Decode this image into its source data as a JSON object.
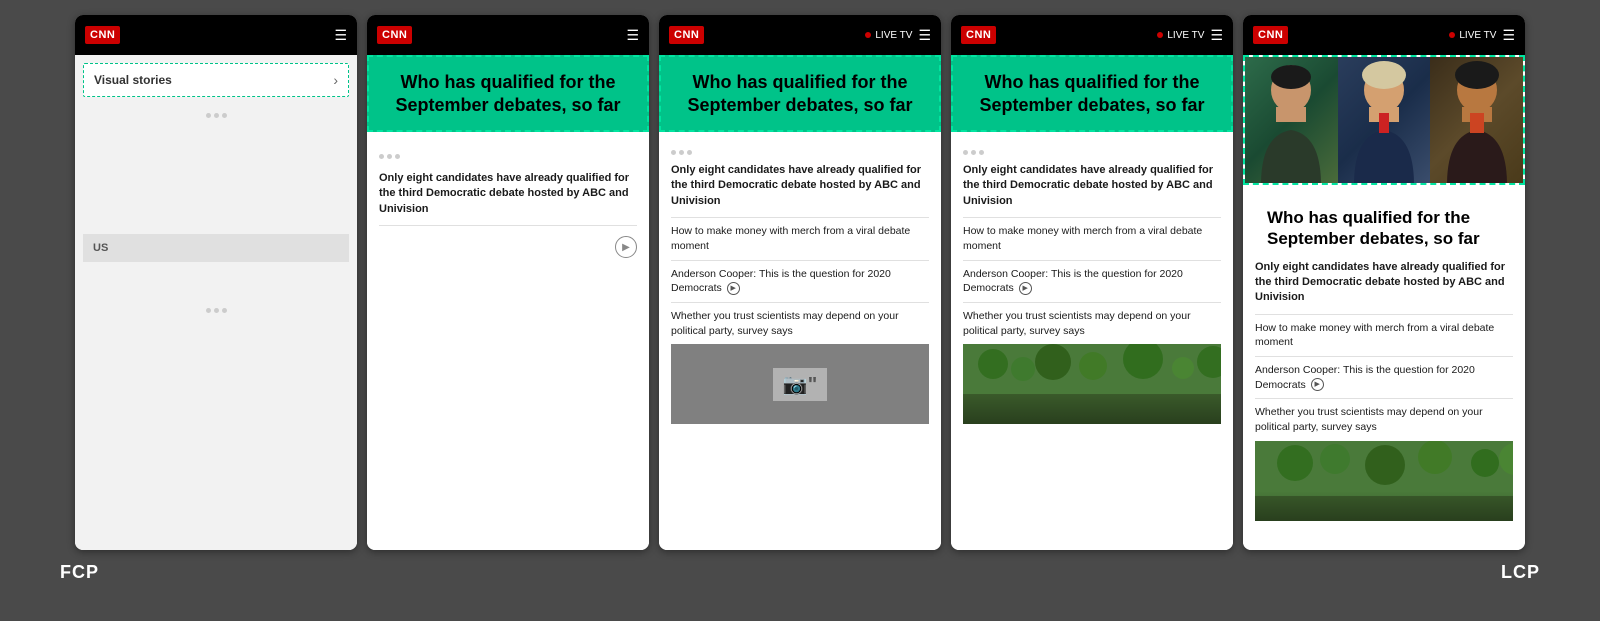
{
  "bg_color": "#4a4a4a",
  "labels": {
    "fcp": "FCP",
    "lcp": "LCP"
  },
  "phones": [
    {
      "id": "phone1",
      "type": "blank",
      "header": {
        "logo": "CNN",
        "live_tv": false
      },
      "visual_stories_label": "Visual stories",
      "us_label": "US"
    },
    {
      "id": "phone2",
      "type": "article",
      "header": {
        "logo": "CNN",
        "live_tv": false
      },
      "headline": "Who has qualified for the September debates, so far",
      "headline_dashed": true,
      "headline_green": true,
      "sub_text": "Only eight candidates have already qualified for the third Democratic debate hosted by ABC and Univision",
      "links": [],
      "has_video": false,
      "has_image": false
    },
    {
      "id": "phone3",
      "type": "article",
      "header": {
        "logo": "CNN",
        "live_tv": true,
        "live_tv_label": "LIVE TV"
      },
      "headline": "Who has qualified for the September debates, so far",
      "headline_dashed": true,
      "headline_green": true,
      "sub_text": "Only eight candidates have already qualified for the third Democratic debate hosted by ABC and Univision",
      "links": [
        "How to make money with merch from a viral debate moment",
        "Anderson Cooper: This is the question for 2020 Democrats",
        "Whether you trust scientists may depend on your political party, survey says"
      ],
      "has_video": true,
      "has_image": false
    },
    {
      "id": "phone4",
      "type": "article",
      "header": {
        "logo": "CNN",
        "live_tv": true,
        "live_tv_label": "LIVE TV"
      },
      "headline": "Who has qualified for the September debates, so far",
      "headline_dashed": true,
      "headline_green": true,
      "sub_text": "Only eight candidates have already qualified for the third Democratic debate hosted by ABC and Univision",
      "links": [
        "How to make money with merch from a viral debate moment",
        "Anderson Cooper: This is the question for 2020 Democrats",
        "Whether you trust scientists may depend on your political party, survey says"
      ],
      "has_video": false,
      "has_image": true,
      "image_type": "outdoor"
    },
    {
      "id": "phone5",
      "type": "article",
      "header": {
        "logo": "CNN",
        "live_tv": true,
        "live_tv_label": "LIVE TV"
      },
      "headline": "Who has qualified for the September debates, so far",
      "headline_dashed": false,
      "headline_green": false,
      "sub_text": "Only eight candidates have already qualified for the third Democratic debate hosted by ABC and Univision",
      "links": [
        "How to make money with merch from a viral debate moment",
        "Anderson Cooper: This is the question for 2020 Democrats",
        "Whether you trust scientists may depend on your political party, survey says"
      ],
      "has_video": false,
      "has_image": true,
      "image_type": "candidates"
    }
  ]
}
